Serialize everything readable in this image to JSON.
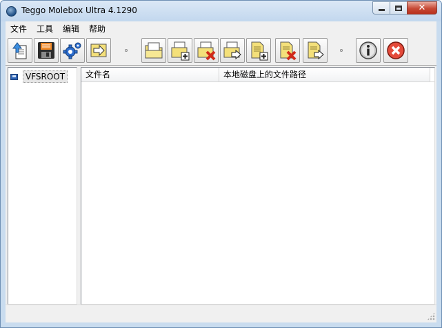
{
  "window": {
    "title": "Teggo Molebox Ultra 4.1290",
    "minimize_glyph": "",
    "maximize_glyph": "",
    "close_glyph": "✕"
  },
  "menu": [
    "文件",
    "工具",
    "编辑",
    "帮助"
  ],
  "toolbar": {
    "buttons": [
      {
        "icon": "open-project-icon"
      },
      {
        "icon": "save-icon"
      },
      {
        "icon": "settings-gear-icon"
      },
      {
        "icon": "build-arrow-icon"
      },
      {
        "icon": "new-folder-icon"
      },
      {
        "icon": "add-folder-icon"
      },
      {
        "icon": "remove-folder-icon"
      },
      {
        "icon": "move-folder-icon"
      },
      {
        "icon": "add-file-icon"
      },
      {
        "icon": "remove-file-icon"
      },
      {
        "icon": "move-file-icon"
      },
      {
        "icon": "info-icon"
      },
      {
        "icon": "exit-icon"
      }
    ]
  },
  "tree": {
    "root_label": "VFSROOT"
  },
  "file_list": {
    "columns": [
      "文件名",
      "本地磁盘上的文件路径"
    ],
    "rows": []
  },
  "colors": {
    "window_frame": "#c9dcef",
    "close_button": "#c74a36",
    "folder_yellow": "#f4e07a",
    "delete_red": "#d12a1a",
    "gear_blue": "#2e6fd0"
  }
}
